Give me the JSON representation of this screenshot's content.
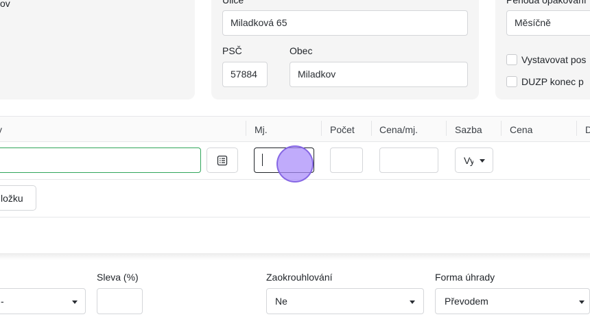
{
  "address": {
    "ulice_label": "Ulice",
    "ulice_value": "Miladková 65",
    "psc_label": "PSČ",
    "psc_value": "57884",
    "obec_label": "Obec",
    "obec_value": "Miladkov"
  },
  "left_card": {
    "partial_text": "ov"
  },
  "recurrence": {
    "period_label": "Perioda opakování",
    "period_value": "Měsíčně",
    "checkbox_issue_label": "Vystavovat pos",
    "checkbox_duzp_label": "DUZP konec p"
  },
  "items_table": {
    "headers": {
      "name": "y",
      "unit": "Mj.",
      "count": "Počet",
      "unit_price": "Cena/mj.",
      "rate": "Sazba",
      "price": "Cena",
      "more": "D"
    },
    "row": {
      "name_value": "",
      "unit_value": "",
      "count_value": "",
      "unit_price_value": "",
      "rate_value": "Vy"
    },
    "add_item_label": "ložku"
  },
  "footer": {
    "first_select_value": "-",
    "discount_label": "Sleva (%)",
    "discount_value": "",
    "rounding_label": "Zaokrouhlování",
    "rounding_value": "Ne",
    "payment_label": "Forma úhrady",
    "payment_value": "Převodem"
  },
  "colors": {
    "focus_green": "#2fa55a",
    "cursor_purple": "#a78bfa"
  }
}
